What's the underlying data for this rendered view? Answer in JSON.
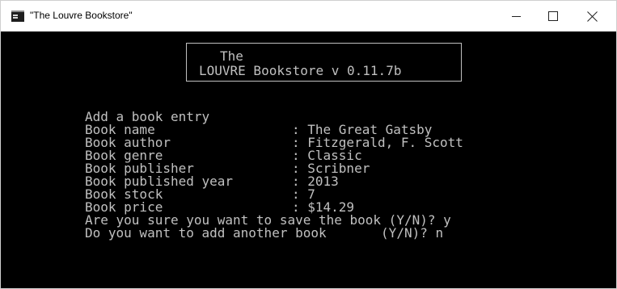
{
  "window": {
    "title": "\"The Louvre Bookstore\"",
    "controls": {
      "minimize": "minimize",
      "maximize": "maximize",
      "close": "close"
    }
  },
  "header": {
    "line1": "The",
    "line2": "LOUVRE Bookstore v 0.11.7b"
  },
  "entry": {
    "heading": "Add a book entry",
    "fields": [
      {
        "label": "Book name",
        "value": "The Great Gatsby"
      },
      {
        "label": "Book author",
        "value": "Fitzgerald, F. Scott"
      },
      {
        "label": "Book genre",
        "value": "Classic"
      },
      {
        "label": "Book publisher",
        "value": "Scribner"
      },
      {
        "label": "Book published year",
        "value": "2013"
      },
      {
        "label": "Book stock",
        "value": "7"
      },
      {
        "label": "Book price",
        "value": "$14.29"
      }
    ],
    "separator": ": ",
    "confirm_save": "Are you sure you want to save the book (Y/N)? y",
    "add_another": "Do you want to add another book       (Y/N)? n"
  },
  "colors": {
    "console_bg": "#000000",
    "console_text": "#c0c0c0",
    "titlebar_bg": "#ffffff"
  }
}
